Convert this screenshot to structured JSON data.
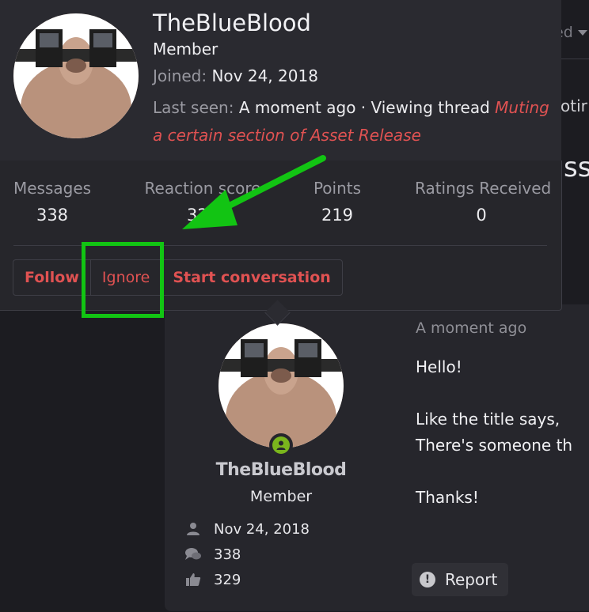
{
  "background": {
    "top_right_text": "ed",
    "line1_text": "otir",
    "line2_text": "sse"
  },
  "popup": {
    "username": "TheBlueBlood",
    "role": "Member",
    "joined_label": "Joined:",
    "joined_value": "Nov 24, 2018",
    "last_seen_label": "Last seen:",
    "last_seen_value": "A moment ago · Viewing thread",
    "thread_link": "Muting a certain section of Asset Release",
    "stats": [
      {
        "label": "Messages",
        "value": "338"
      },
      {
        "label": "Reaction score",
        "value": "329"
      },
      {
        "label": "Points",
        "value": "219"
      },
      {
        "label": "Ratings Received",
        "value": "0"
      }
    ],
    "buttons": {
      "follow": "Follow",
      "ignore": "Ignore",
      "start_conversation": "Start conversation"
    }
  },
  "post": {
    "username": "TheBlueBlood",
    "role": "Member",
    "joined": "Nov 24, 2018",
    "messages": "338",
    "reactions": "329",
    "time": "A moment ago",
    "body": "Hello!\n\nLike the title says,\nThere's someone th\n\nThanks!",
    "report_label": "Report"
  },
  "colors": {
    "accent_red": "#e05252",
    "annotation_green": "#12c413",
    "online_green": "#7ab51d"
  }
}
